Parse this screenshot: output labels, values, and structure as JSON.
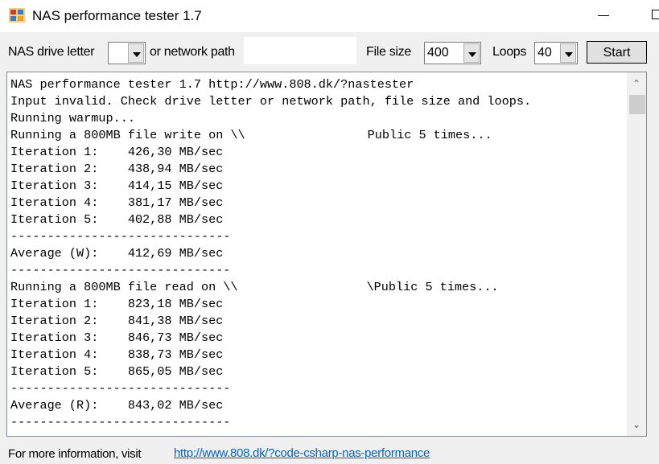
{
  "window": {
    "title": "NAS performance tester 1.7",
    "icon": "app-icon",
    "minimize_icon": "minimize-icon",
    "maximize_icon": "maximize-icon"
  },
  "toolbar": {
    "drive_label": "NAS drive letter",
    "drive_value": "",
    "network_label": "or network path",
    "network_path_value": "",
    "filesize_label": "File size",
    "filesize_value": "400",
    "loops_label": "Loops",
    "loops_value": "40",
    "start_label": "Start"
  },
  "output": {
    "lines": [
      "NAS performance tester 1.7 http://www.808.dk/?nastester",
      "Input invalid. Check drive letter or network path, file size and loops.",
      "Running warmup...",
      {
        "before": "Running a 800MB file write on \\\\",
        "after": "Public 5 times..."
      },
      "Iteration 1:    426,30 MB/sec",
      "Iteration 2:    438,94 MB/sec",
      "Iteration 3:    414,15 MB/sec",
      "Iteration 4:    381,17 MB/sec",
      "Iteration 5:    402,88 MB/sec",
      "------------------------------",
      "Average (W):    412,69 MB/sec",
      "------------------------------",
      {
        "before": "Running a 800MB file read on \\\\",
        "after": "\\Public 5 times..."
      },
      "Iteration 1:    823,18 MB/sec",
      "Iteration 2:    841,38 MB/sec",
      "Iteration 3:    846,73 MB/sec",
      "Iteration 4:    838,73 MB/sec",
      "Iteration 5:    865,05 MB/sec",
      "------------------------------",
      "Average (R):    843,02 MB/sec",
      "------------------------------"
    ]
  },
  "footer": {
    "text": "For more information, visit",
    "link": "http://www.808.dk/?code-csharp-nas-performance"
  }
}
